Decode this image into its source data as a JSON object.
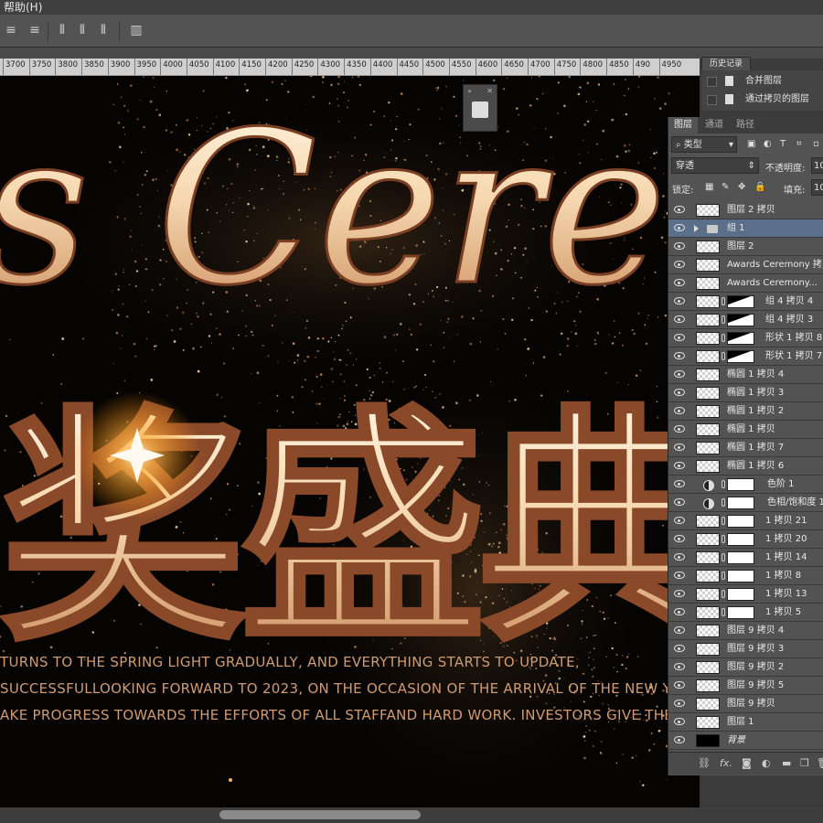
{
  "menubar": {
    "help": "帮助(H)"
  },
  "ruler": {
    "ticks": [
      "3700",
      "3750",
      "3800",
      "3850",
      "3900",
      "3950",
      "4000",
      "4050",
      "4100",
      "4150",
      "4200",
      "4250",
      "4300",
      "4350",
      "4400",
      "4450",
      "4500",
      "4550",
      "4600",
      "4650",
      "4700",
      "4750",
      "4800",
      "4850",
      "490",
      "4950"
    ]
  },
  "canvas": {
    "title_en": "s Ceren",
    "title_cn": "奖盛典",
    "body_lines": [
      "TURNS TO THE SPRING LIGHT GRADUALLY, AND EVERYTHING STARTS TO UPDATE,",
      "SUCCESSFULLOOKING FORWARD TO 2023, ON THE OCCASION OF THE ARRIVAL OF THE NEW YEAR",
      "AKE PROGRESS TOWARDS THE EFFORTS OF ALL STAFFAND HARD WORK. INVESTORS GIVE THEIR SINC"
    ],
    "accent": "#d7a074",
    "gold_light": "#fff1d6",
    "gold_dark": "#8a4a2a"
  },
  "history": {
    "tab": "历史记录",
    "items": [
      "合并图层",
      "通过拷贝的图层"
    ]
  },
  "layers_panel": {
    "tabs": [
      "图层",
      "通道",
      "路径"
    ],
    "filter_kind": "类型",
    "blend_mode": "穿透",
    "opacity_label": "不透明度:",
    "opacity_value": "10",
    "lock_label": "锁定:",
    "fill_label": "填充:",
    "fill_value": "10",
    "layers": [
      {
        "name": "图层 2 拷贝",
        "kind": "pixel"
      },
      {
        "name": "组 1",
        "kind": "group",
        "selected": true
      },
      {
        "name": "图层 2",
        "kind": "pixel"
      },
      {
        "name": "Awards Ceremony 拷贝",
        "kind": "pixel"
      },
      {
        "name": "Awards Ceremony...",
        "kind": "pixel"
      },
      {
        "name": "组 4 拷贝 4",
        "kind": "masked-dark"
      },
      {
        "name": "组 4 拷贝 3",
        "kind": "masked-dark"
      },
      {
        "name": "形状 1 拷贝 8",
        "kind": "masked-dark"
      },
      {
        "name": "形状 1 拷贝 7",
        "kind": "masked-dark"
      },
      {
        "name": "椭圆 1 拷贝 4",
        "kind": "pixel"
      },
      {
        "name": "椭圆 1 拷贝 3",
        "kind": "pixel"
      },
      {
        "name": "椭圆 1 拷贝 2",
        "kind": "pixel"
      },
      {
        "name": "椭圆 1 拷贝",
        "kind": "pixel"
      },
      {
        "name": "椭圆 1 拷贝 7",
        "kind": "pixel"
      },
      {
        "name": "椭圆 1 拷贝 6",
        "kind": "pixel"
      },
      {
        "name": "色阶 1",
        "kind": "adjustment"
      },
      {
        "name": "色相/饱和度 1",
        "kind": "adjustment"
      },
      {
        "name": "1 拷贝 21",
        "kind": "masked"
      },
      {
        "name": "1 拷贝 20",
        "kind": "masked"
      },
      {
        "name": "1 拷贝 14",
        "kind": "masked"
      },
      {
        "name": "1 拷贝 8",
        "kind": "masked"
      },
      {
        "name": "1 拷贝 13",
        "kind": "masked"
      },
      {
        "name": "1 拷贝 5",
        "kind": "masked"
      },
      {
        "name": "图层 9 拷贝 4",
        "kind": "pixel"
      },
      {
        "name": "图层 9 拷贝 3",
        "kind": "pixel"
      },
      {
        "name": "图层 9 拷贝 2",
        "kind": "pixel"
      },
      {
        "name": "图层 9 拷贝 5",
        "kind": "pixel"
      },
      {
        "name": "图层 9 拷贝",
        "kind": "pixel"
      },
      {
        "name": "图层 1",
        "kind": "pixel"
      },
      {
        "name": "背景",
        "kind": "background"
      }
    ],
    "footer_icons": [
      "link-icon",
      "fx-icon",
      "mask-icon",
      "adjustment-icon",
      "folder-icon",
      "new-layer-icon",
      "trash-icon"
    ]
  }
}
